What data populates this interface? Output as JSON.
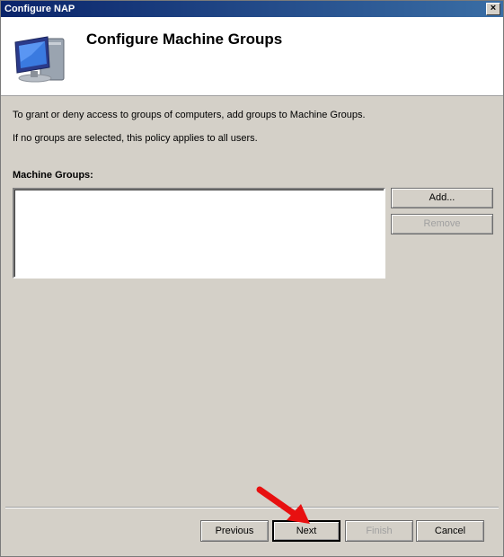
{
  "window": {
    "title": "Configure NAP",
    "close_label": "×"
  },
  "header": {
    "title": "Configure Machine Groups",
    "icon": "computer-monitor-icon"
  },
  "body": {
    "line1": "To grant or deny access to groups of computers, add groups to Machine Groups.",
    "line2": "If no groups are selected, this policy applies to all users.",
    "list_label": "Machine Groups:",
    "items": []
  },
  "side_buttons": {
    "add": "Add...",
    "remove": "Remove"
  },
  "footer": {
    "previous": "Previous",
    "next": "Next",
    "finish": "Finish",
    "cancel": "Cancel"
  },
  "colors": {
    "titlebar": "#0a246a",
    "dialog_bg": "#d4d0c8",
    "annotation_arrow": "#e81010"
  }
}
